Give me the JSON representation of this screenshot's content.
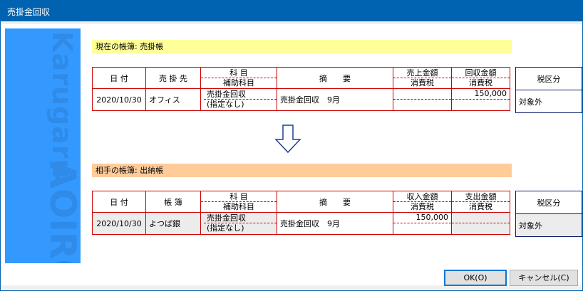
{
  "window": {
    "title": "売掛金回収"
  },
  "side": {
    "brand_top": "Karugaru",
    "brand_bottom": "AOIRO"
  },
  "current": {
    "label": "現在の帳簿: 売掛帳",
    "headers": {
      "date": "日 付",
      "partner": "売 掛 先",
      "account": "科 目",
      "sub_account": "補助科目",
      "summary": "摘　　要",
      "amount1": "売上金額",
      "tax1": "消費税",
      "amount2": "回収金額",
      "tax2": "消費税",
      "tax_class": "税区分"
    },
    "row": {
      "date": "2020/10/30",
      "partner": "オフィス",
      "account": "売掛金回収",
      "sub_account": "(指定なし)",
      "summary": "売掛金回収　9月",
      "amount1": "",
      "tax1": "",
      "amount2": "150,000",
      "tax2": "",
      "tax_class": "対象外"
    }
  },
  "other": {
    "label": "相手の帳簿: 出納帳",
    "headers": {
      "date": "日 付",
      "book": "帳 簿",
      "account": "科 目",
      "sub_account": "補助科目",
      "summary": "摘　　要",
      "amount1": "収入金額",
      "tax1": "消費税",
      "amount2": "支出金額",
      "tax2": "消費税",
      "tax_class": "税区分"
    },
    "row": {
      "date": "2020/10/30",
      "book": "よつば銀",
      "account": "売掛金回収",
      "sub_account": "(指定なし)",
      "summary": "売掛金回収　9月",
      "amount1": "150,000",
      "tax1": "",
      "amount2": "",
      "tax2": "",
      "tax_class": "対象外"
    }
  },
  "buttons": {
    "ok": "OK(O)",
    "cancel": "キャンセル(C)"
  },
  "colors": {
    "accent": "#0063b1",
    "current_band": "#ffff99",
    "other_band": "#ffcc99",
    "grid": "#cc0000",
    "tax_border": "#0a1f6e",
    "side": "#3399ff"
  }
}
